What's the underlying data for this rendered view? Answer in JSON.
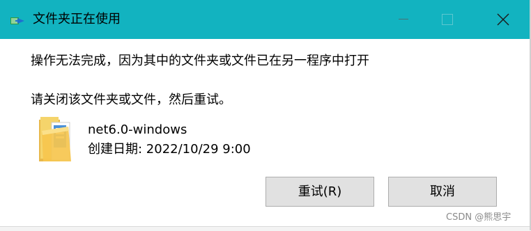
{
  "window": {
    "title": "文件夹正在使用",
    "title_icon": "folder-move-icon",
    "controls": [
      "minimize-icon",
      "maximize-icon",
      "close-icon"
    ],
    "accent": "#12b3c0"
  },
  "message": {
    "line1": "操作无法完成，因为其中的文件夹或文件已在另一程序中打开",
    "line2": "请关闭该文件夹或文件，然后重试。"
  },
  "item": {
    "icon": "folder-icon",
    "name": "net6.0-windows",
    "date_label": "创建日期: 2022/10/29 9:00"
  },
  "buttons": {
    "retry_label": "重试(R)",
    "cancel_label": "取消"
  },
  "watermark": "CSDN @熊思宇"
}
